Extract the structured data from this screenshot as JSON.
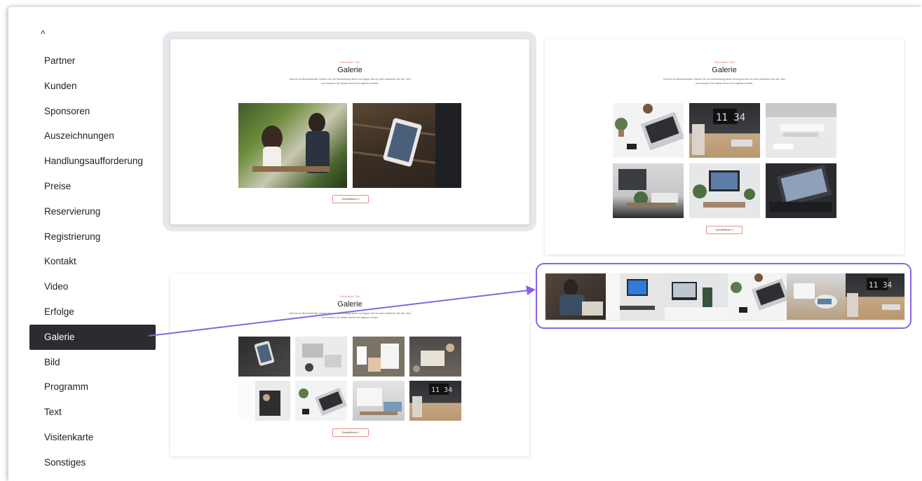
{
  "sidebar": {
    "collapse_icon": "chevron-up-icon",
    "collapse_glyph": "^",
    "items": [
      {
        "label": "Partner"
      },
      {
        "label": "Kunden"
      },
      {
        "label": "Sponsoren"
      },
      {
        "label": "Auszeichnungen"
      },
      {
        "label": "Handlungsaufforderung"
      },
      {
        "label": "Preise"
      },
      {
        "label": "Reservierung"
      },
      {
        "label": "Registrierung"
      },
      {
        "label": "Kontakt"
      },
      {
        "label": "Video"
      },
      {
        "label": "Erfolge"
      },
      {
        "label": "Galerie"
      },
      {
        "label": "Bild"
      },
      {
        "label": "Programm"
      },
      {
        "label": "Text"
      },
      {
        "label": "Visitenkarte"
      },
      {
        "label": "Sonstiges"
      }
    ],
    "active_index": 11
  },
  "templates": {
    "card1": {
      "subtitle": "Sekundärer Titel",
      "title": "Galerie",
      "description": "Dies ist ein Blockuntertitel. Klicken Sie zur Bearbeitung hinein und tippen Sie los oder markieren Sie den Text und ersetzen Sie diesen durch Ihre eigenen Inhalte.",
      "button": "Schaltfläche 2"
    },
    "card2": {
      "subtitle": "Sekundärer Titel",
      "title": "Galerie",
      "description": "Dies ist ein Blockuntertitel. Klicken Sie zur Bearbeitung hinein und tippen Sie los oder markieren Sie den Text und ersetzen Sie diesen durch Ihre eigenen Inhalte.",
      "button": "Schaltfläche 2"
    },
    "card3": {
      "subtitle": "Sekundärer Titel",
      "title": "Galerie",
      "description": "Dies ist ein Blockuntertitel. Klicken Sie zur Bearbeitung hinein und tippen Sie los oder markieren Sie den Text und ersetzen Sie diesen durch Ihre eigenen Inhalte.",
      "button": "Schaltfläche 2"
    }
  },
  "colors": {
    "accent": "#8a63e3",
    "active_item_bg": "#2b2c30",
    "subtitle": "#e07a6e",
    "selected_bg": "#e7e8ec"
  }
}
